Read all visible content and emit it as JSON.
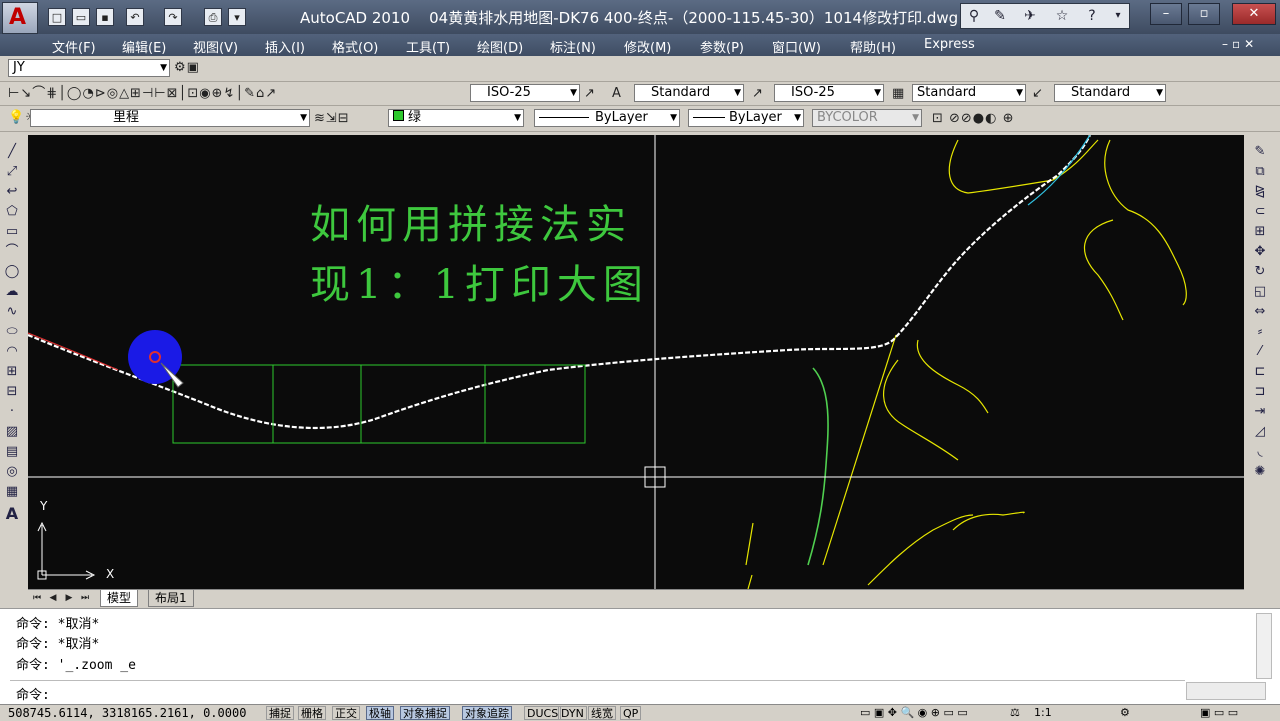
{
  "title": {
    "app": "AutoCAD 2010",
    "document": "04黄黄排水用地图-DK76 400-终点-（2000-115.45-30）1014修改打印.dwg"
  },
  "menu": [
    "文件(F)",
    "编辑(E)",
    "视图(V)",
    "插入(I)",
    "格式(O)",
    "工具(T)",
    "绘图(D)",
    "标注(N)",
    "修改(M)",
    "参数(P)",
    "窗口(W)",
    "帮助(H)",
    "Express"
  ],
  "toolbar": {
    "workspace": "JY",
    "dimstyle1": "ISO-25",
    "textstyle": "Standard",
    "dimstyle2": "ISO-25",
    "tablestyle": "Standard",
    "mleaderstyle": "Standard",
    "layer": "里程",
    "color": "绿",
    "linetype": "ByLayer",
    "lineweight": "ByLayer",
    "plotstyle": "BYCOLOR"
  },
  "canvas": {
    "overlay_line1": "如何用拼接法实",
    "overlay_line2": "现1：1打印大图",
    "ucs_x": "X",
    "ucs_y": "Y",
    "line_color": "#ffffff",
    "overlay_color": "#3ec83e",
    "frame_color": "#2ec82e",
    "road_color": "#e6e600"
  },
  "tabs": {
    "model": "模型",
    "layout1": "布局1"
  },
  "command": {
    "lines": [
      "命令: *取消*",
      "命令: *取消*",
      "命令: '_.zoom _e"
    ],
    "prompt": "命令:"
  },
  "status": {
    "coords": "508745.6114,  3318165.2161,  0.0000",
    "buttons": [
      {
        "label": "捕捉",
        "on": false
      },
      {
        "label": "栅格",
        "on": false
      },
      {
        "label": "正交",
        "on": false
      },
      {
        "label": "极轴",
        "on": true
      },
      {
        "label": "对象捕捉",
        "on": true
      },
      {
        "label": "对象追踪",
        "on": true
      },
      {
        "label": "DUCS",
        "on": false
      },
      {
        "label": "DYN",
        "on": false
      },
      {
        "label": "线宽",
        "on": false
      },
      {
        "label": "QP",
        "on": false
      }
    ],
    "scale": "1:1"
  }
}
